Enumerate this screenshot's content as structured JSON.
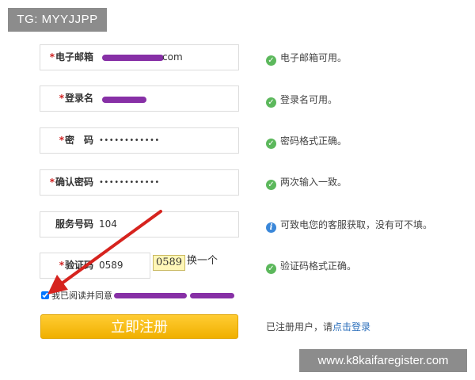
{
  "watermarks": {
    "top": "TG: MYYJJPP",
    "bottom": "www.k8kaifaregister.com"
  },
  "form": {
    "email": {
      "label": "电子邮箱",
      "value_suffix": "com",
      "hint": "电子邮箱可用。"
    },
    "username": {
      "label": "登录名",
      "hint": "登录名可用。"
    },
    "password": {
      "label": "密　码",
      "value": "••••••••••••",
      "hint": "密码格式正确。"
    },
    "confirm": {
      "label": "确认密码",
      "value": "••••••••••••",
      "hint": "两次输入一致。"
    },
    "service": {
      "label": "服务号码",
      "value": "104",
      "hint": "可致电您的客服获取，没有可不填。"
    },
    "captcha": {
      "label": "验证码",
      "value": "0589",
      "image_text": "0589",
      "refresh_label": "换一个",
      "hint": "验证码格式正确。"
    },
    "required_mark": "*"
  },
  "agreement": {
    "text": "我已阅读并同意",
    "checked": true
  },
  "submit": {
    "label": "立即注册"
  },
  "login_prompt": {
    "text": "已注册用户，请",
    "link": "点击登录"
  },
  "colors": {
    "required": "#d02020",
    "ok": "#5cb85c",
    "info": "#3a87d9",
    "button": "#f7be17",
    "arrow": "#d6231e",
    "redaction": "#7a1a9c"
  },
  "icons": {
    "ok": "check-circle-icon",
    "info": "info-circle-icon"
  }
}
